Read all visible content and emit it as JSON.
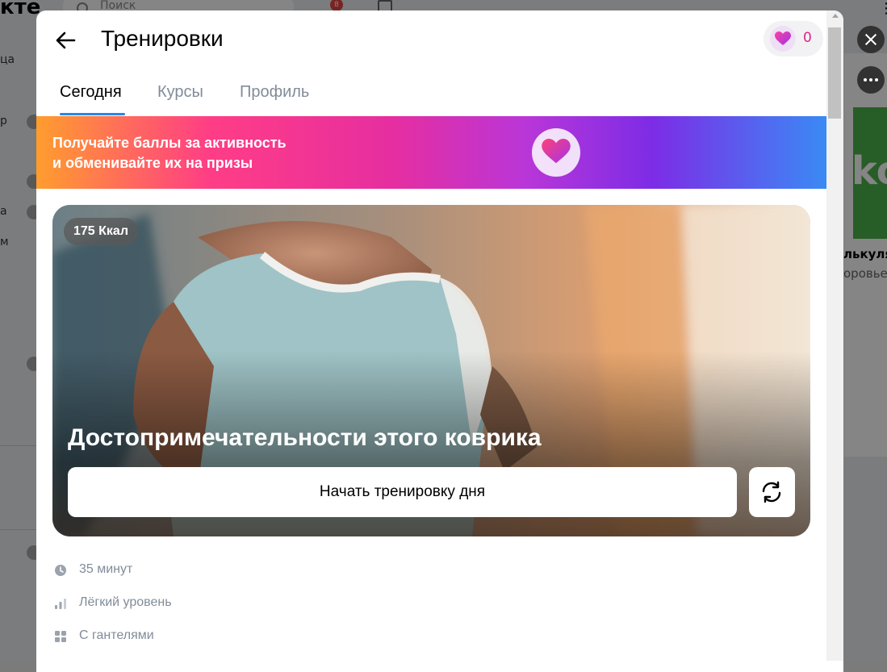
{
  "background": {
    "logo": "кте",
    "search_placeholder": "Поиск",
    "notification_count": "8",
    "left_labels": [
      "ца",
      "р",
      "а",
      "м"
    ],
    "right_card_title": "лькуля",
    "right_card_sub": "оровье",
    "right_card_badge": "ko"
  },
  "modal": {
    "title": "Тренировки",
    "points": "0",
    "tabs": [
      {
        "label": "Сегодня",
        "active": true
      },
      {
        "label": "Курсы",
        "active": false
      },
      {
        "label": "Профиль",
        "active": false
      }
    ],
    "promo": {
      "line1": "Получайте баллы за активность",
      "line2": "и обменивайте их на призы"
    },
    "workout": {
      "kcal": "175 Ккал",
      "title": "Достопримечательности этого коврика",
      "start_button": "Начать тренировку дня",
      "details": [
        {
          "icon": "clock-icon",
          "text": "35 минут"
        },
        {
          "icon": "level-bars-icon",
          "text": "Лёгкий уровень"
        },
        {
          "icon": "equipment-grid-icon",
          "text": "С гантелями"
        }
      ]
    }
  },
  "colors": {
    "accent_blue": "#2688eb",
    "points_pink": "#e0218a",
    "secondary_text": "#818c99"
  }
}
